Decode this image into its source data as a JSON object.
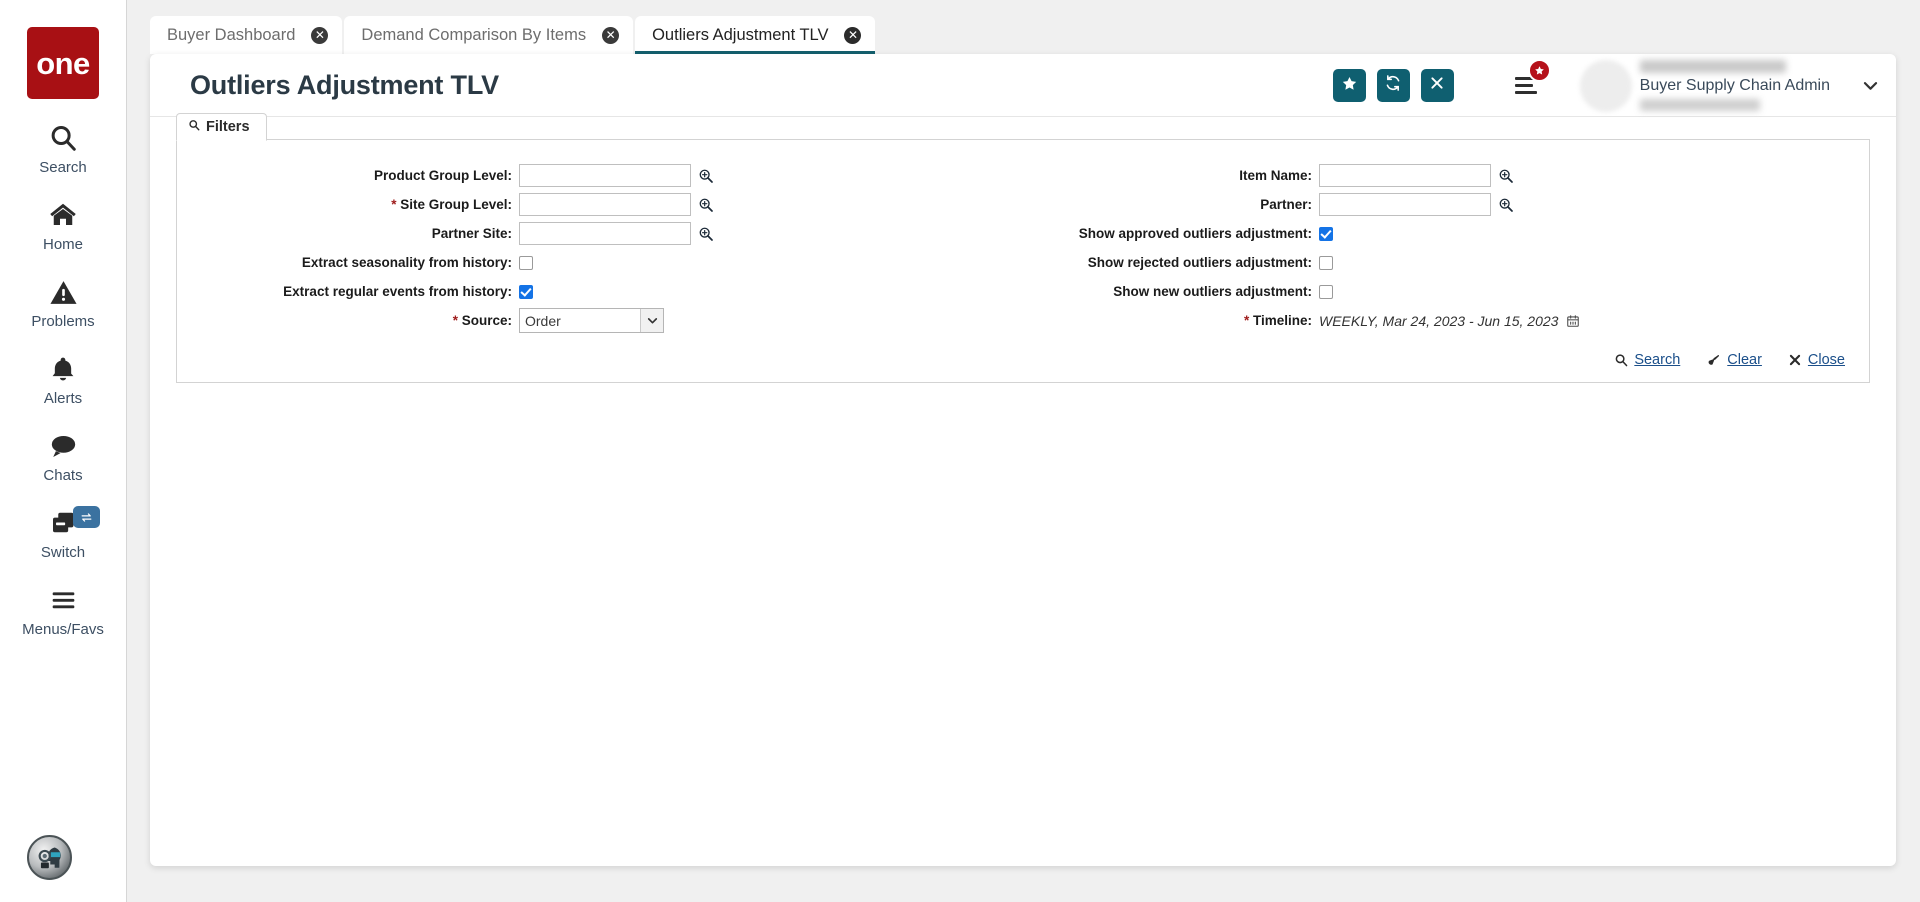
{
  "brand": {
    "logo_text": "one",
    "accent": "#0f5f70",
    "logo_bg": "#a81014"
  },
  "rail": {
    "items": [
      {
        "label": "Search",
        "icon": "search-icon"
      },
      {
        "label": "Home",
        "icon": "home-icon"
      },
      {
        "label": "Problems",
        "icon": "warning-triangle-icon"
      },
      {
        "label": "Alerts",
        "icon": "bell-icon"
      },
      {
        "label": "Chats",
        "icon": "chat-bubble-icon"
      },
      {
        "label": "Switch",
        "icon": "switch-windows-icon",
        "badge_icon": "swap-arrows-icon"
      },
      {
        "label": "Menus/Favs",
        "icon": "hamburger-icon"
      }
    ],
    "assistant_icon": "ai-assistant-avatar-icon"
  },
  "tabs": [
    {
      "label": "Buyer Dashboard",
      "active": false,
      "close_icon": "close-circle-icon"
    },
    {
      "label": "Demand Comparison By Items",
      "active": false,
      "close_icon": "close-circle-icon"
    },
    {
      "label": "Outliers Adjustment TLV",
      "active": true,
      "close_icon": "close-circle-icon"
    }
  ],
  "header": {
    "title": "Outliers Adjustment TLV",
    "actions": [
      {
        "name": "favorite-button",
        "icon": "star-icon"
      },
      {
        "name": "refresh-button",
        "icon": "refresh-icon"
      },
      {
        "name": "close-button",
        "icon": "x-icon"
      }
    ],
    "menu_icon": "hamburger-menu-icon",
    "menu_badge_icon": "star-badge-icon",
    "user": {
      "role": "Buyer Supply Chain Admin",
      "caret_icon": "chevron-down-icon",
      "avatar_icon": "user-avatar"
    }
  },
  "filters": {
    "tab_label": "Filters",
    "tab_icon": "search-icon",
    "left": [
      {
        "type": "text",
        "label": "Product Group Level:",
        "required": false,
        "value": "",
        "placeholder": "",
        "lookup_icon": "magnifier-plus-icon"
      },
      {
        "type": "text",
        "label": "Site Group Level:",
        "required": true,
        "value": "",
        "placeholder": "",
        "lookup_icon": "magnifier-plus-icon"
      },
      {
        "type": "text",
        "label": "Partner Site:",
        "required": false,
        "value": "",
        "placeholder": "",
        "lookup_icon": "magnifier-plus-icon"
      },
      {
        "type": "checkbox",
        "label": "Extract seasonality from history:",
        "required": false,
        "checked": false
      },
      {
        "type": "checkbox",
        "label": "Extract regular events from history:",
        "required": false,
        "checked": true
      },
      {
        "type": "select",
        "label": "Source:",
        "required": true,
        "value": "Order",
        "options": [
          "Order"
        ],
        "caret_icon": "chevron-down-icon"
      }
    ],
    "right": [
      {
        "type": "text",
        "label": "Item Name:",
        "required": false,
        "value": "",
        "placeholder": "",
        "lookup_icon": "magnifier-plus-icon"
      },
      {
        "type": "text",
        "label": "Partner:",
        "required": false,
        "value": "",
        "placeholder": "",
        "lookup_icon": "magnifier-plus-icon"
      },
      {
        "type": "checkbox",
        "label": "Show approved outliers adjustment:",
        "required": false,
        "checked": true
      },
      {
        "type": "checkbox",
        "label": "Show rejected outliers adjustment:",
        "required": false,
        "checked": false
      },
      {
        "type": "checkbox",
        "label": "Show new outliers adjustment:",
        "required": false,
        "checked": false
      },
      {
        "type": "timeline",
        "label": "Timeline:",
        "required": true,
        "value": "WEEKLY, Mar 24, 2023 - Jun 15, 2023",
        "calendar_icon": "calendar-icon"
      }
    ],
    "actions": [
      {
        "label": "Search",
        "icon": "search-icon",
        "name": "search-link"
      },
      {
        "label": "Clear",
        "icon": "eraser-icon",
        "name": "clear-link"
      },
      {
        "label": "Close",
        "icon": "x-icon",
        "name": "close-link"
      }
    ]
  }
}
